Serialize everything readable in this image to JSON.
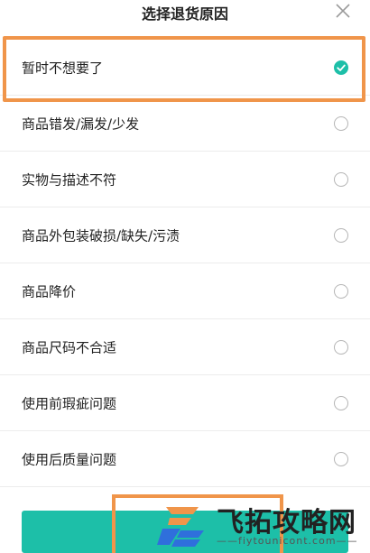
{
  "header": {
    "title": "选择退货原因",
    "close_icon": "close-icon"
  },
  "reasons": [
    {
      "label": "暂时不想要了",
      "checked": true
    },
    {
      "label": "商品错发/漏发/少发",
      "checked": false
    },
    {
      "label": "实物与描述不符",
      "checked": false
    },
    {
      "label": "商品外包装破损/缺失/污渍",
      "checked": false
    },
    {
      "label": "商品降价",
      "checked": false
    },
    {
      "label": "商品尺码不合适",
      "checked": false
    },
    {
      "label": "使用前瑕疵问题",
      "checked": false
    },
    {
      "label": "使用后质量问题",
      "checked": false
    }
  ],
  "colors": {
    "accent": "#1dbfa8",
    "highlight": "#f0954a"
  },
  "watermark": {
    "text": "飞拓攻略网",
    "url": "——fiytounicont.com——"
  }
}
